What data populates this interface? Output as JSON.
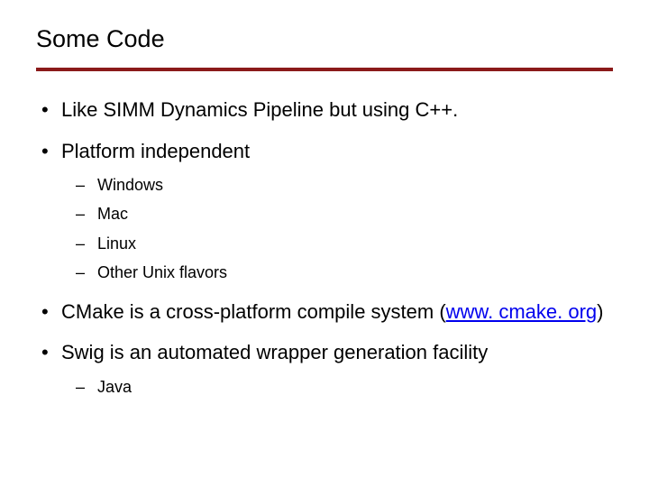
{
  "title": "Some Code",
  "bullets": {
    "b1": "Like SIMM Dynamics Pipeline but using C++.",
    "b2": "Platform independent",
    "b2_subs": {
      "s1": "Windows",
      "s2": "Mac",
      "s3": "Linux",
      "s4": "Other Unix flavors"
    },
    "b3_pre": "CMake is a cross-platform compile system (",
    "b3_link": "www. cmake. org",
    "b3_post": ")",
    "b4": "Swig is an automated wrapper generation facility",
    "b4_subs": {
      "s1": "Java"
    }
  }
}
